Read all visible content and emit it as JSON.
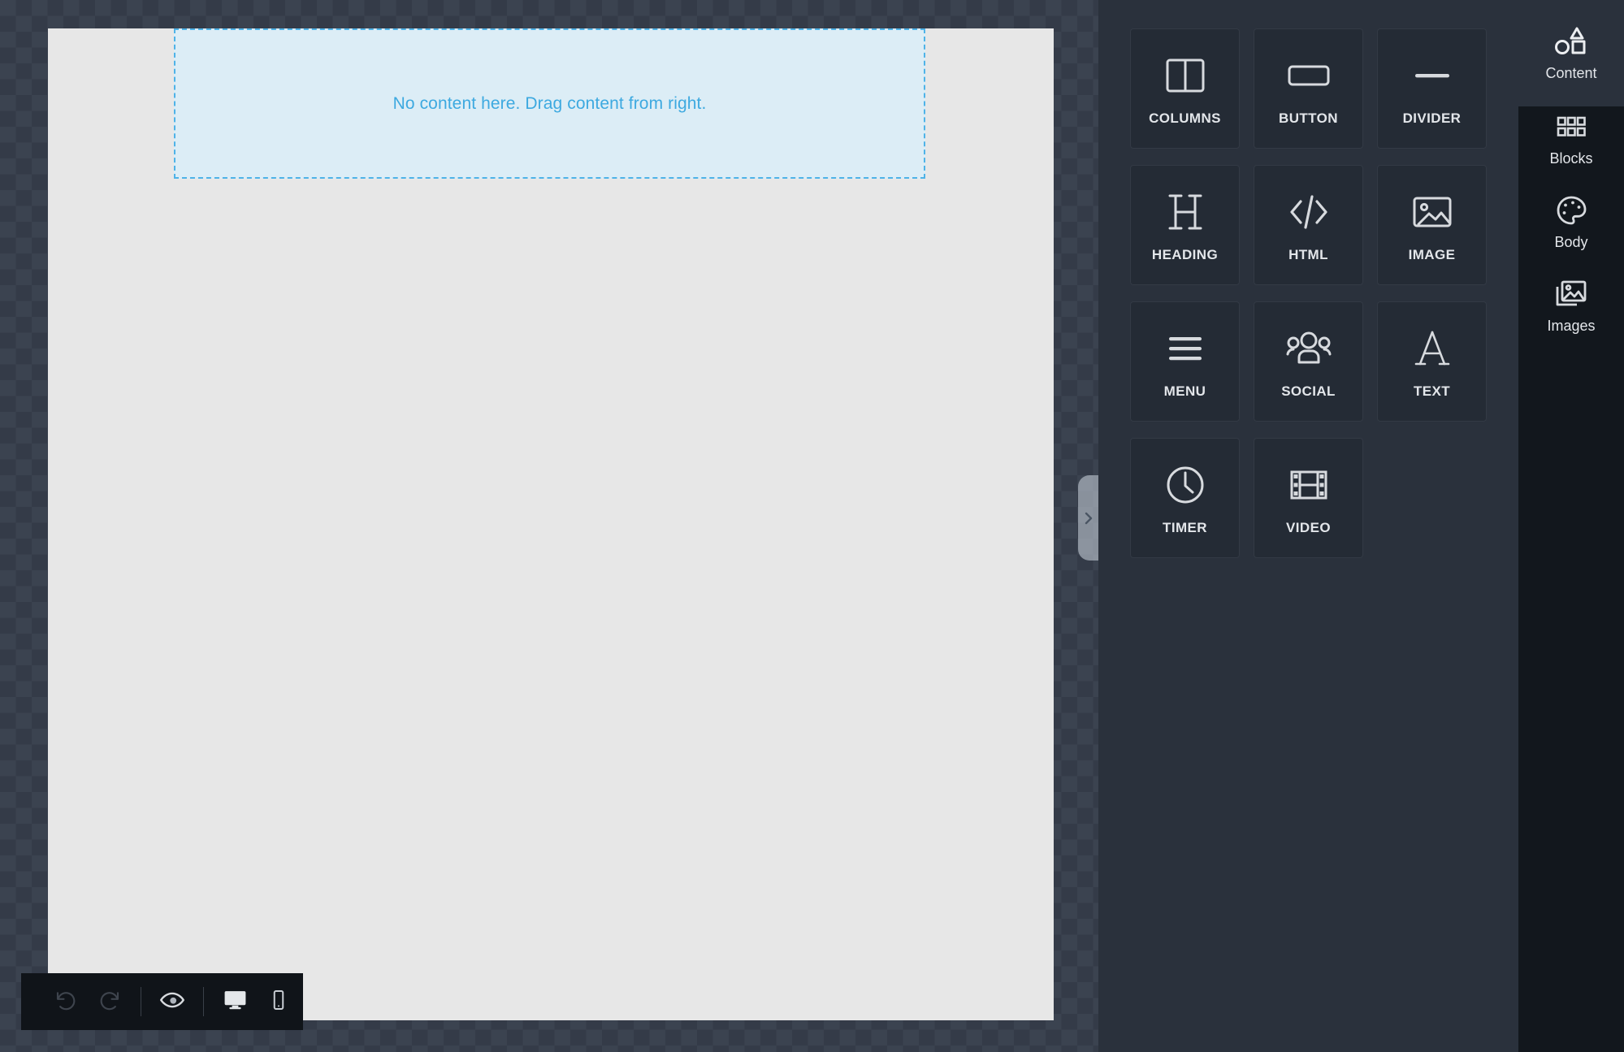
{
  "canvas": {
    "drop_zone": {
      "text": "No content here. Drag content from right."
    },
    "collapse_handle": {
      "icon": "chevron-right-icon"
    }
  },
  "bottom_toolbar": {
    "buttons": [
      {
        "name": "undo",
        "icon": "undo-icon",
        "state": "disabled"
      },
      {
        "name": "redo",
        "icon": "redo-icon",
        "state": "disabled"
      },
      {
        "name": "preview",
        "icon": "eye-icon",
        "state": "enabled"
      },
      {
        "name": "desktop-view",
        "icon": "desktop-icon",
        "state": "enabled"
      },
      {
        "name": "mobile-view",
        "icon": "mobile-icon",
        "state": "enabled"
      }
    ]
  },
  "content_panel": {
    "tiles": [
      {
        "label": "COLUMNS",
        "icon": "columns-icon"
      },
      {
        "label": "BUTTON",
        "icon": "button-icon"
      },
      {
        "label": "DIVIDER",
        "icon": "divider-icon"
      },
      {
        "label": "HEADING",
        "icon": "heading-icon"
      },
      {
        "label": "HTML",
        "icon": "code-icon"
      },
      {
        "label": "IMAGE",
        "icon": "image-icon"
      },
      {
        "label": "MENU",
        "icon": "hamburger-icon"
      },
      {
        "label": "SOCIAL",
        "icon": "people-icon"
      },
      {
        "label": "TEXT",
        "icon": "letter-a-icon"
      },
      {
        "label": "TIMER",
        "icon": "clock-icon"
      },
      {
        "label": "VIDEO",
        "icon": "film-icon"
      }
    ]
  },
  "right_rail": {
    "items": [
      {
        "label": "Content",
        "icon": "shapes-icon",
        "active": true
      },
      {
        "label": "Blocks",
        "icon": "grid-icon",
        "active": false
      },
      {
        "label": "Body",
        "icon": "palette-icon",
        "active": false
      },
      {
        "label": "Images",
        "icon": "photos-icon",
        "active": false
      }
    ]
  },
  "colors": {
    "canvas_checker_light": "#3b4350",
    "canvas_checker_dark": "#343b48",
    "page_background": "#e7e7e7",
    "dropzone_fill": "#dcedf6",
    "dropzone_border": "#4eb3e8",
    "dropzone_text": "#3da9e0",
    "panel_background": "#2a313c",
    "tile_background": "#242b35",
    "rail_background": "#12171d",
    "toolbar_background": "#101419",
    "icon_light": "#d7dade"
  }
}
